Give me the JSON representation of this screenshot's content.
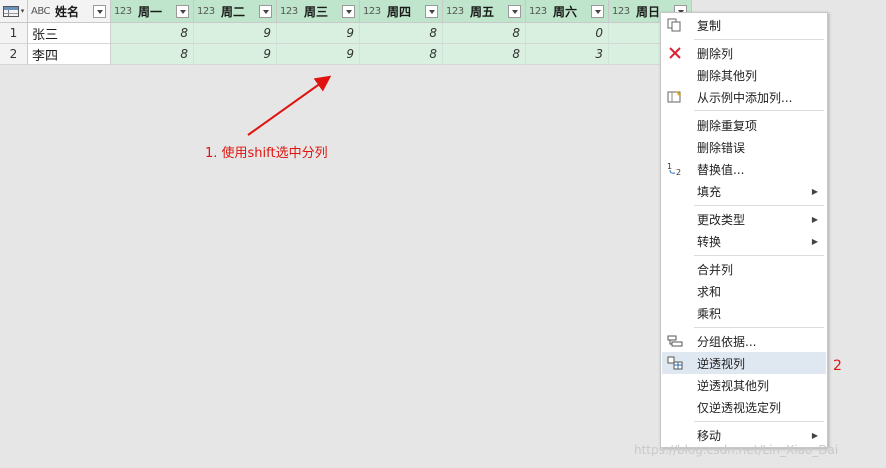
{
  "grid": {
    "name_header": "姓名",
    "name_type": "ABC",
    "num_type": "123",
    "day_headers": [
      "周一",
      "周二",
      "周三",
      "周四",
      "周五",
      "周六",
      "周日"
    ],
    "rows": [
      {
        "num": "1",
        "name": "张三",
        "values": [
          "8",
          "9",
          "9",
          "8",
          "8",
          "0",
          ""
        ]
      },
      {
        "num": "2",
        "name": "李四",
        "values": [
          "8",
          "9",
          "9",
          "8",
          "8",
          "3",
          ""
        ]
      }
    ]
  },
  "annotation": {
    "step1": "1. 使用shift选中分列",
    "step2": "2",
    "color": "#e0140f"
  },
  "menu": {
    "items": [
      {
        "label": "复制",
        "icon": "copy-icon"
      },
      {
        "label": "删除列",
        "icon": "delete-column-icon"
      },
      {
        "label": "删除其他列",
        "icon": ""
      },
      {
        "label": "从示例中添加列...",
        "icon": "column-from-examples-icon"
      },
      {
        "label": "删除重复项",
        "icon": ""
      },
      {
        "label": "删除错误",
        "icon": ""
      },
      {
        "label": "替换值...",
        "icon": "replace-values-icon"
      },
      {
        "label": "填充",
        "icon": ""
      },
      {
        "label": "更改类型",
        "icon": ""
      },
      {
        "label": "转换",
        "icon": ""
      },
      {
        "label": "合并列",
        "icon": ""
      },
      {
        "label": "求和",
        "icon": ""
      },
      {
        "label": "乘积",
        "icon": ""
      },
      {
        "label": "分组依据...",
        "icon": "group-by-icon"
      },
      {
        "label": "逆透视列",
        "icon": "unpivot-icon"
      },
      {
        "label": "逆透视其他列",
        "icon": ""
      },
      {
        "label": "仅逆透视选定列",
        "icon": ""
      },
      {
        "label": "移动",
        "icon": ""
      }
    ],
    "highlight_color": "#dfe7f1"
  },
  "watermark": "https://blog.csdn.net/Lin_Xiao_Dai"
}
